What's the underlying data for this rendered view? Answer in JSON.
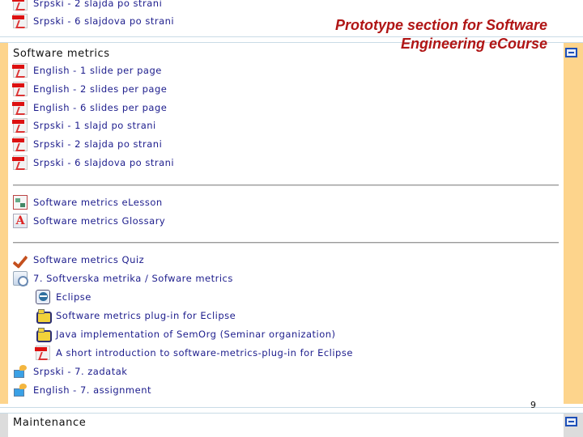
{
  "slide": {
    "title": "Prototype section for Software Engineering eCourse",
    "page_number": "9"
  },
  "previous_section": {
    "items": [
      {
        "label": "Srpski - 2 slajda po strani",
        "icon": "pdf-icon"
      },
      {
        "label": "Srpski - 6 slajdova po strani",
        "icon": "pdf-icon"
      }
    ]
  },
  "current_section": {
    "title": "Software metrics",
    "slides": [
      {
        "label": "English - 1 slide per page",
        "icon": "pdf-icon"
      },
      {
        "label": "English - 2 slides per page",
        "icon": "pdf-icon"
      },
      {
        "label": "English - 6 slides per page",
        "icon": "pdf-icon"
      },
      {
        "label": "Srpski - 1 slajd po strani",
        "icon": "pdf-icon"
      },
      {
        "label": "Srpski - 2 slajda po strani",
        "icon": "pdf-icon"
      },
      {
        "label": "Srpski - 6 slajdova po strani",
        "icon": "pdf-icon"
      }
    ],
    "lessons": [
      {
        "label": "Software metrics eLesson",
        "icon": "elesson-icon"
      },
      {
        "label": "Software metrics Glossary",
        "icon": "glossary-icon"
      }
    ],
    "activities": [
      {
        "label": "Software metrics Quiz",
        "icon": "quiz-icon"
      },
      {
        "label": "7. Softverska metrika / Sofware metrics",
        "icon": "resource-folder-icon"
      }
    ],
    "sub_resources": [
      {
        "label": "Eclipse",
        "icon": "eclipse-icon"
      },
      {
        "label": "Software metrics plug-in for Eclipse",
        "icon": "plugin-icon"
      },
      {
        "label": "Java implementation of SemOrg (Seminar organization)",
        "icon": "plugin-icon"
      },
      {
        "label": "A short introduction to software-metrics-plug-in for Eclipse",
        "icon": "pdf-icon"
      }
    ],
    "assignments": [
      {
        "label": "Srpski - 7. zadatak",
        "icon": "assignment-icon"
      },
      {
        "label": "English - 7. assignment",
        "icon": "assignment-icon"
      }
    ],
    "collapse_label": "−"
  },
  "maintenance_section": {
    "title": "Maintenance",
    "collapse_label": "−"
  },
  "colors": {
    "current_section_accent": "#fdd48c",
    "other_section_accent": "#dcdcdc",
    "link": "#1c1c8c",
    "slide_title": "#b01515"
  }
}
